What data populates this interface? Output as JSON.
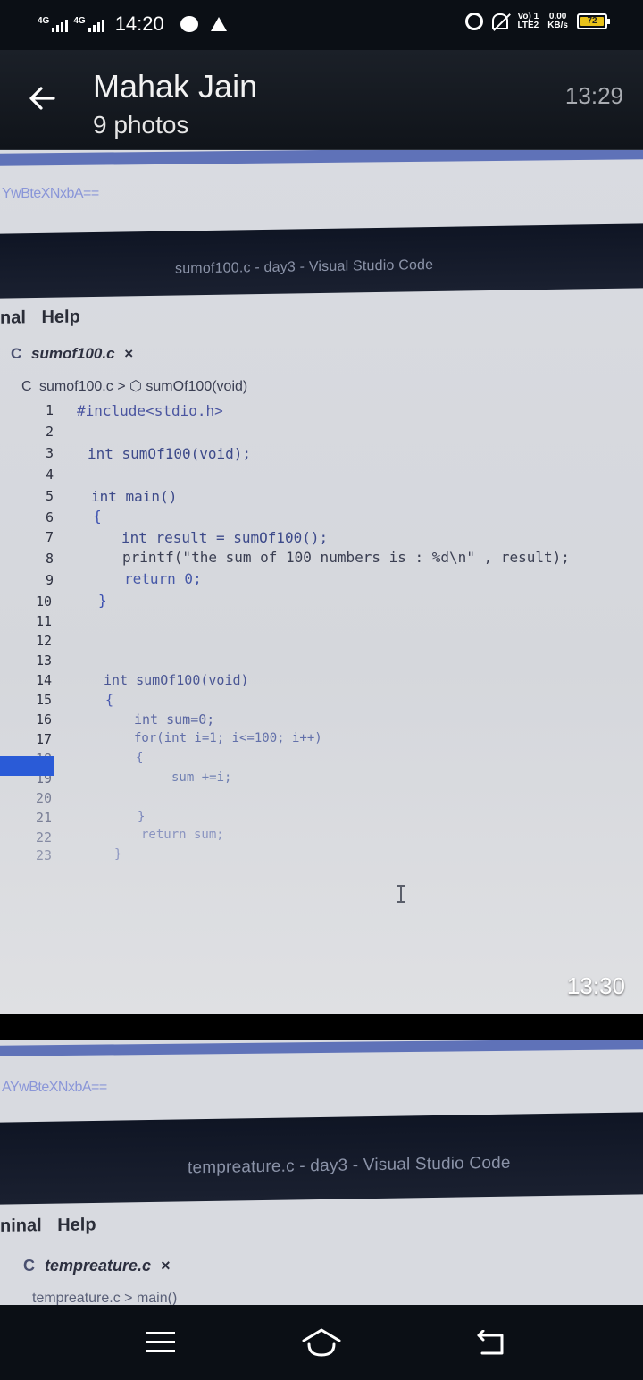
{
  "status_bar": {
    "network_1": "4G",
    "network_2": "4G",
    "time": "14:20",
    "volte_line1": "Vo) 1",
    "volte_line2": "LTE2",
    "speed_line1": "0.00",
    "speed_line2": "KB/s",
    "battery_level": "72"
  },
  "header": {
    "contact_name": "Mahak Jain",
    "subtitle": "9 photos",
    "time": "13:29"
  },
  "photo1": {
    "encoded_strip": "YwBteXNxbA==",
    "window_title": "sumof100.c - day3 - Visual Studio Code",
    "menu": [
      "nal",
      "Help"
    ],
    "file_tab": "sumof100.c",
    "file_tab_close": "×",
    "breadcrumb_file": "sumof100.c",
    "breadcrumb_symbol": "sumOf100(void)",
    "line_numbers": [
      "1",
      "2",
      "3",
      "4",
      "5",
      "6",
      "7",
      "8",
      "9",
      "10",
      "11",
      "12",
      "13",
      "14",
      "15",
      "16",
      "17",
      "18",
      "19",
      "20",
      "21",
      "22",
      "23"
    ],
    "code_lines": [
      "#include<stdio.h>",
      "int sumOf100(void);",
      "int main()",
      "{",
      "int result = sumOf100();",
      "printf(\"the sum of 100 numbers is : %d\\n\" , result);",
      "return 0;",
      "}",
      "int sumOf100(void)",
      "{",
      "int sum=0;",
      "for(int i=1; i<=100; i++)",
      "{",
      "sum +=i;",
      "}",
      "return sum;",
      "}"
    ],
    "time": "13:30"
  },
  "photo2": {
    "encoded_strip": "AYwBteXNxbA==",
    "window_title": "tempreature.c - day3 - Visual Studio Code",
    "menu": [
      "ninal",
      "Help"
    ],
    "file_tab": "tempreature.c",
    "file_tab_close": "×",
    "breadcrumb": "tempreature.c > main()"
  }
}
